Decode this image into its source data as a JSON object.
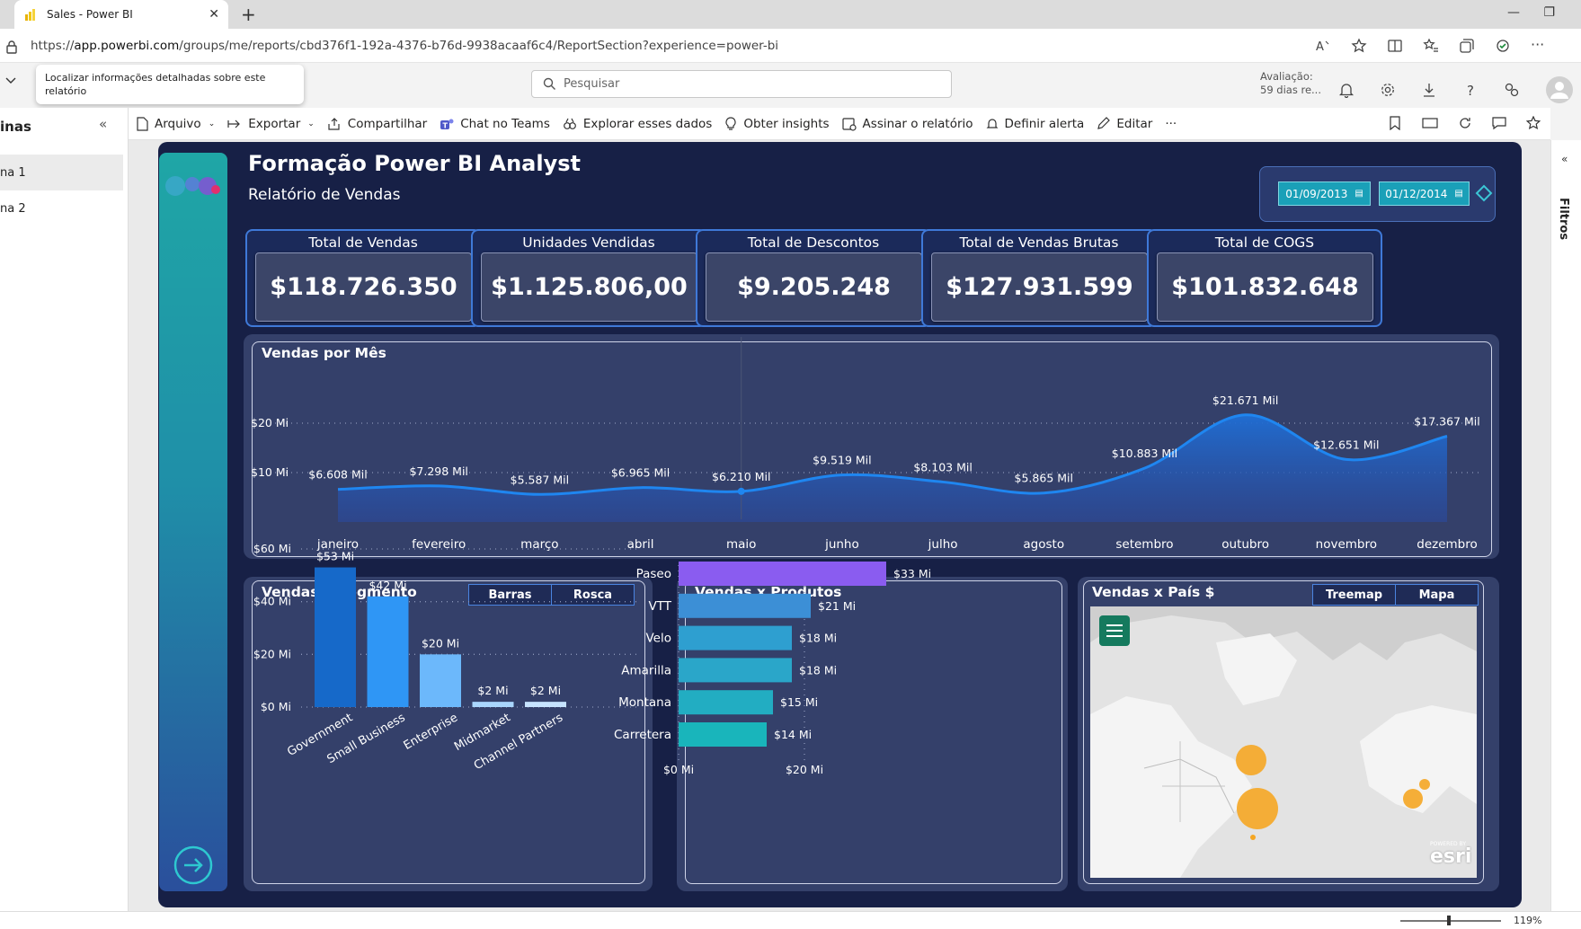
{
  "browser": {
    "tab_title": "Sales - Power BI",
    "url_prefix": "https://",
    "url_host": "app.powerbi.com",
    "url_path": "/groups/me/reports/cbd376f1-192a-4376-b76d-9938acaaf6c4/ReportSection?experience=power-bi"
  },
  "header": {
    "search_placeholder": "Pesquisar",
    "trial_line1": "Avaliação:",
    "trial_line2": "59 dias re..."
  },
  "tooltip": "Localizar informações detalhadas sobre este relatório",
  "pages_pane": {
    "title": "inas",
    "items": [
      "na 1",
      "na 2"
    ]
  },
  "actionbar": {
    "arquivo": "Arquivo",
    "exportar": "Exportar",
    "compartilhar": "Compartilhar",
    "teams": "Chat no Teams",
    "explorar": "Explorar esses dados",
    "insights": "Obter insights",
    "assinar": "Assinar o relatório",
    "alerta": "Definir alerta",
    "editar": "Editar",
    "more": "···"
  },
  "filters_label": "Filtros",
  "zoom": "119%",
  "report": {
    "title": "Formação Power BI Analyst",
    "subtitle": "Relatório de Vendas",
    "date_start": "01/09/2013",
    "date_end": "01/12/2014",
    "kpis": [
      {
        "label": "Total de Vendas",
        "value": "$118.726.350"
      },
      {
        "label": "Unidades Vendidas",
        "value": "$1.125.806,00"
      },
      {
        "label": "Total de Descontos",
        "value": "$9.205.248"
      },
      {
        "label": "Total de Vendas Brutas",
        "value": "$127.931.599"
      },
      {
        "label": "Total de COGS",
        "value": "$101.832.648"
      }
    ],
    "seg_buttons": [
      "Barras",
      "Rosca"
    ],
    "map_title": "Vendas x País $",
    "map_buttons": [
      "Treemap",
      "Mapa"
    ],
    "map_credit": "esri",
    "map_credit_small": "POWERED BY"
  },
  "chart_data": [
    {
      "type": "area",
      "title": "Vendas por Mês",
      "categories": [
        "janeiro",
        "fevereiro",
        "março",
        "abril",
        "maio",
        "junho",
        "julho",
        "agosto",
        "setembro",
        "outubro",
        "novembro",
        "dezembro"
      ],
      "values": [
        6608,
        7298,
        5587,
        6965,
        6210,
        9519,
        8103,
        5865,
        10883,
        21671,
        12651,
        17367
      ],
      "data_labels": [
        "$6.608 Mil",
        "$7.298 Mil",
        "$5.587 Mil",
        "$6.965 Mil",
        "$6.210 Mil",
        "$9.519 Mil",
        "$8.103 Mil",
        "$5.865 Mil",
        "$10.883 Mil",
        "$21.671 Mil",
        "$12.651 Mil",
        "$17.367 Mil"
      ],
      "y_ticks": [
        "$10 Mi",
        "$20 Mi"
      ],
      "y_tick_values": [
        10000,
        20000
      ],
      "ylim": [
        0,
        22000
      ],
      "grid": true,
      "color": "#1f86f0"
    },
    {
      "type": "bar",
      "title": "Vendas x Segmento",
      "categories": [
        "Government",
        "Small Business",
        "Enterprise",
        "Midmarket",
        "Channel Partners"
      ],
      "values": [
        53,
        42,
        20,
        2,
        2
      ],
      "data_labels": [
        "$53 Mi",
        "$42 Mi",
        "$20 Mi",
        "$2 Mi",
        "$2 Mi"
      ],
      "y_ticks": [
        "$0 Mi",
        "$20 Mi",
        "$40 Mi",
        "$60 Mi"
      ],
      "y_tick_values": [
        0,
        20,
        40,
        60
      ],
      "ylim": [
        0,
        60
      ],
      "colors": [
        "#1669c9",
        "#2f96f5",
        "#6cb8fb",
        "#a9d6fd",
        "#c6e3fe"
      ]
    },
    {
      "type": "bar",
      "orientation": "horizontal",
      "title": "Vendas x Produtos",
      "categories": [
        "Paseo",
        "VTT",
        "Velo",
        "Amarilla",
        "Montana",
        "Carretera"
      ],
      "values": [
        33,
        21,
        18,
        18,
        15,
        14
      ],
      "data_labels": [
        "$33 Mi",
        "$21 Mi",
        "$18 Mi",
        "$18 Mi",
        "$15 Mi",
        "$14 Mi"
      ],
      "x_ticks": [
        "$0 Mi",
        "$20 Mi"
      ],
      "x_tick_values": [
        0,
        20
      ],
      "xlim": [
        0,
        40
      ],
      "colors": [
        "#8a5cf0",
        "#3c8fd6",
        "#2e9fd0",
        "#2aa6c9",
        "#22adc2",
        "#19b5bb"
      ]
    }
  ]
}
